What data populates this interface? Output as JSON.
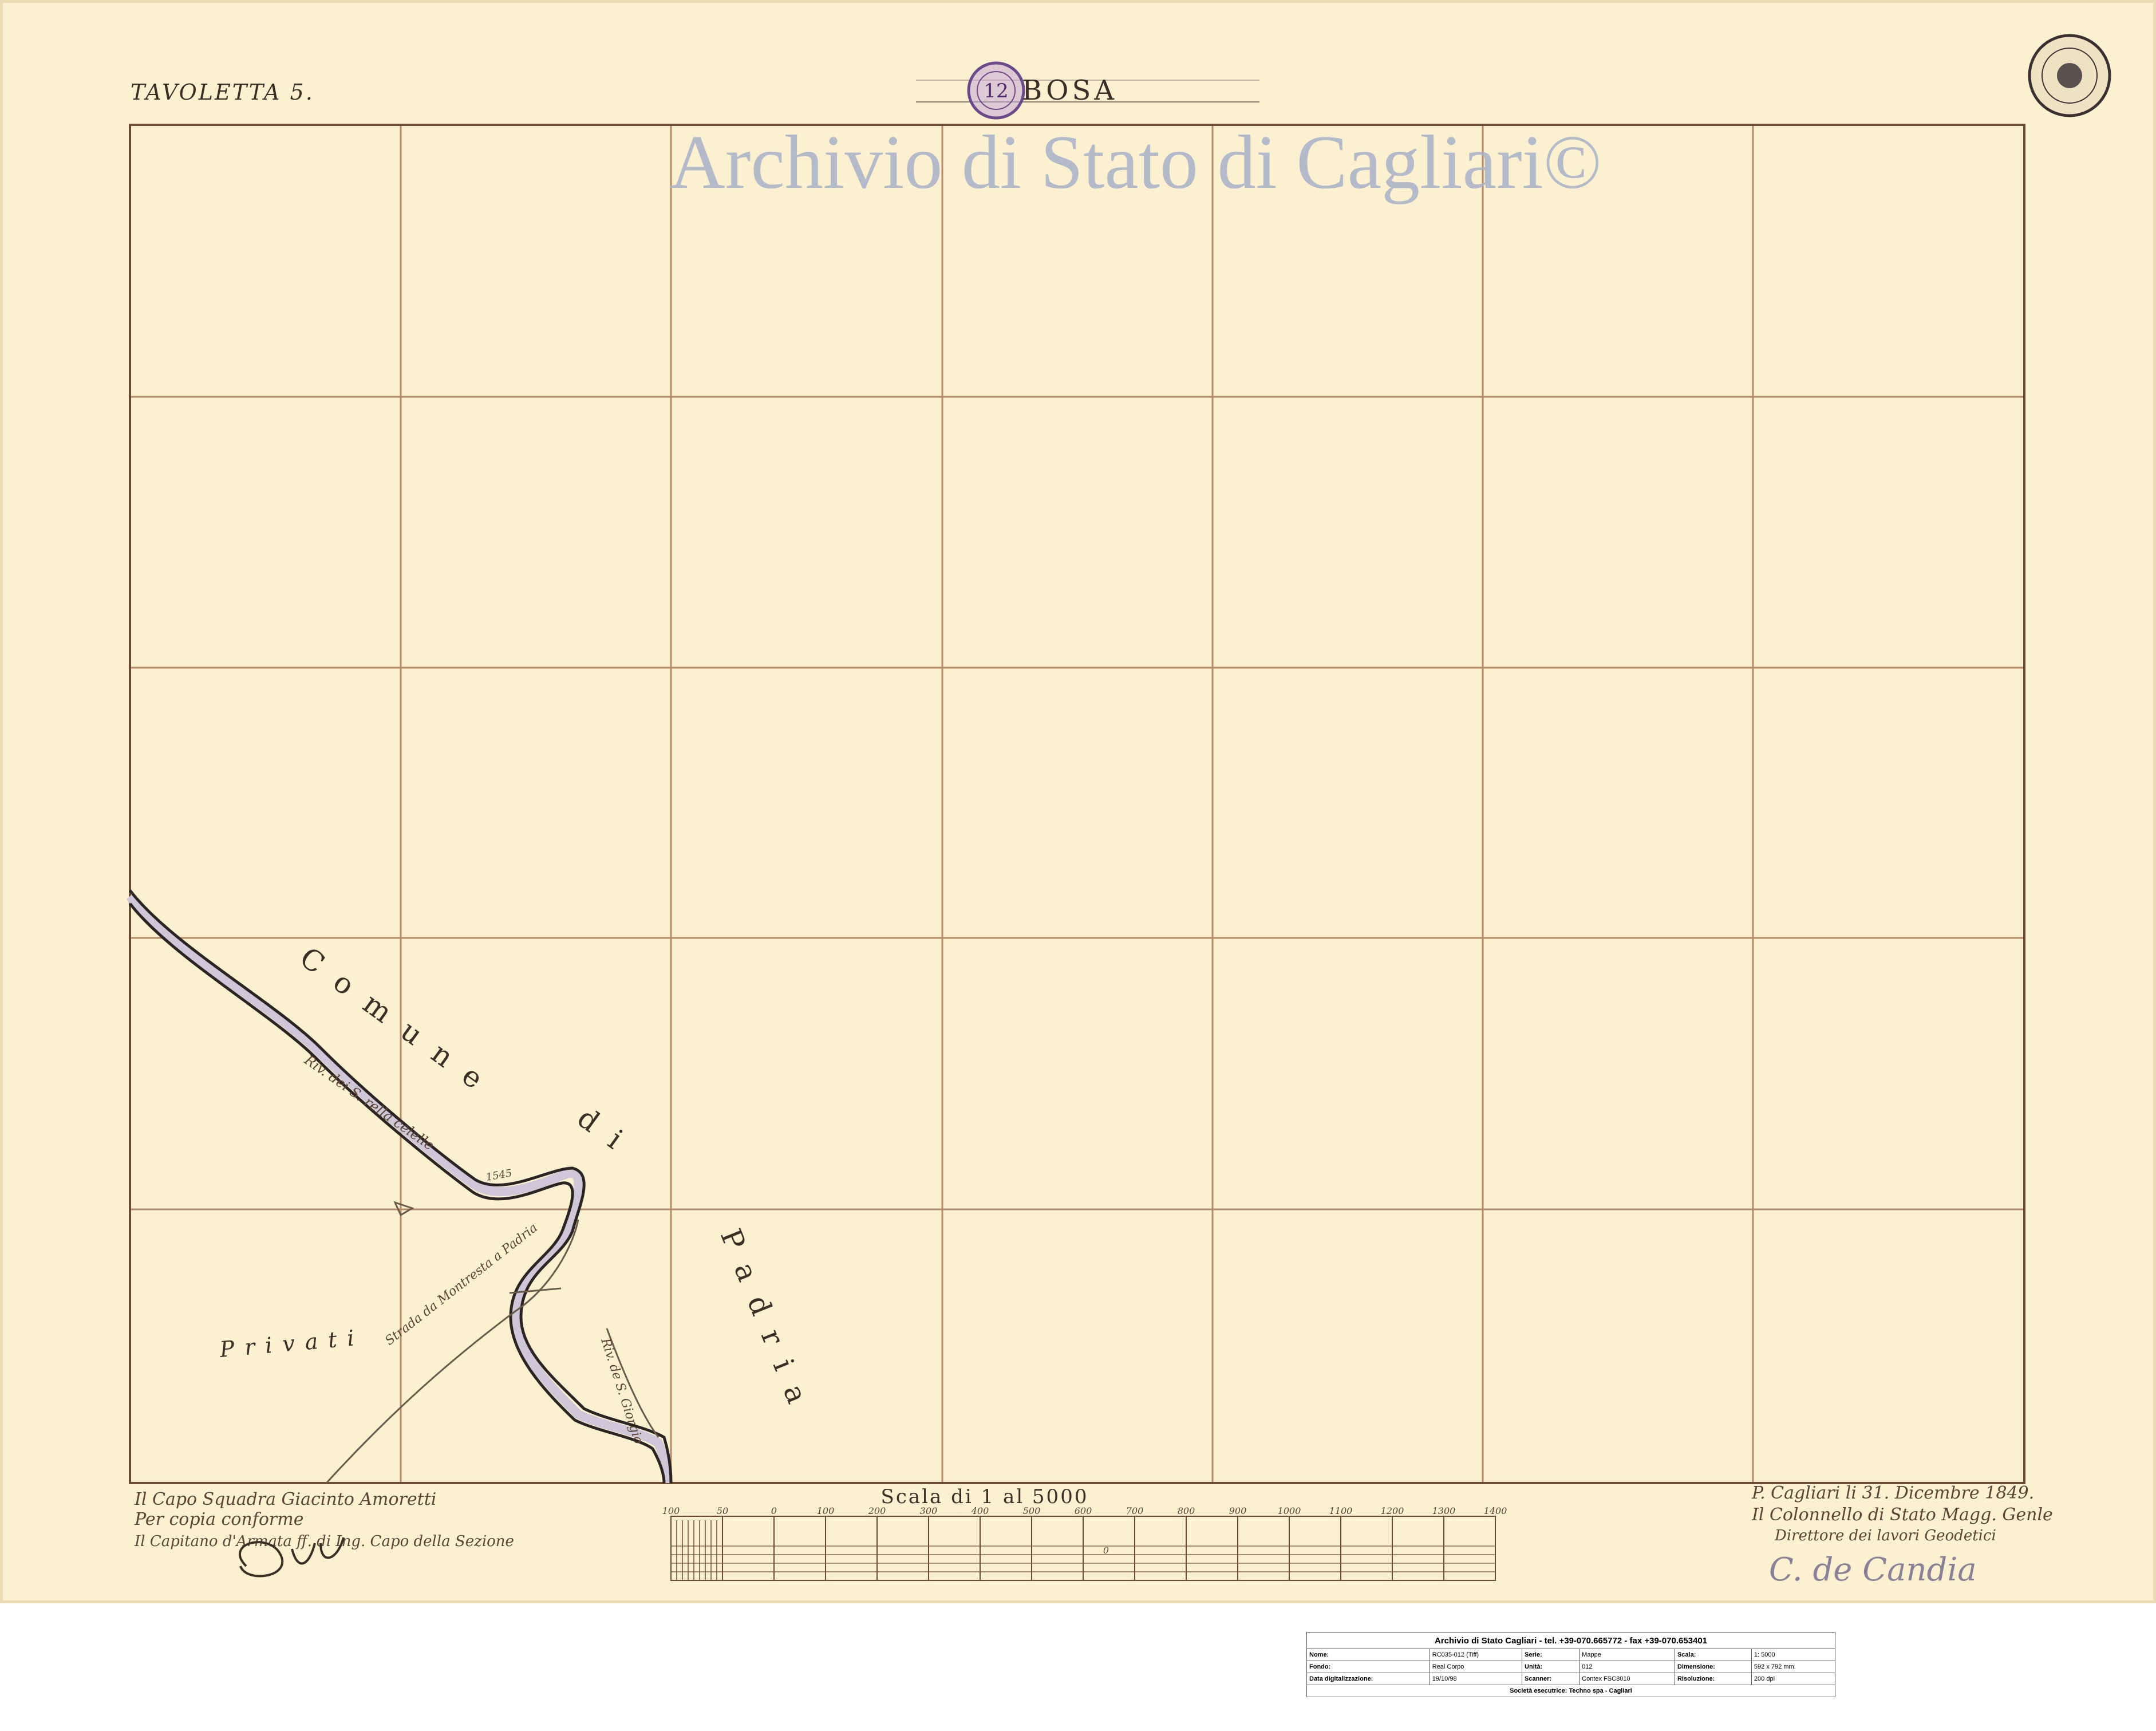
{
  "sheet": {
    "tavoletta": "TAVOLETTA 5.",
    "place": "BOSA",
    "stamp_number": "12",
    "watermark": "Archivio di Stato di Cagliari©"
  },
  "labels": {
    "comune": "Comune",
    "di": "di",
    "padria": "Padria",
    "privati": "Privati",
    "river_upper": "Riv. dei S. rella celelle",
    "river_lower": "Riv. de S. Giorgio",
    "road": "Strada da Montresta a Padria",
    "mark_1545": "1545"
  },
  "scale_bar": {
    "title": "Scala di 1 al 5000",
    "ticks": [
      "100",
      "50",
      "0",
      "100",
      "200",
      "300",
      "400",
      "500",
      "600",
      "700",
      "800",
      "900",
      "1000",
      "1100",
      "1200",
      "1300",
      "1400"
    ],
    "middle_digit": "0"
  },
  "signatures": {
    "left_line1": "Il Capo Squadra Giacinto Amoretti",
    "left_line2": "Per copia conforme",
    "left_line3": "Il Capitano d'Armata ff. di Ing. Capo della Sezione",
    "right_line1": "P. Cagliari li 31. Dicembre 1849.",
    "right_line2": "Il Colonnello di Stato Magg. Genle",
    "right_line3": "Direttore dei lavori Geodetici",
    "right_signature": "C. de Candia"
  },
  "info_table": {
    "header": "Archivio di Stato Cagliari - tel. +39-070.665772 - fax +39-070.653401",
    "rows": [
      [
        "Nome:",
        "RC035-012 (Tiff)",
        "Serie:",
        "Mappe",
        "Scala:",
        "1: 5000"
      ],
      [
        "Fondo:",
        "Real Corpo",
        "Unità:",
        "012",
        "Dimensione:",
        "592 x 792 mm."
      ],
      [
        "Data digitalizzazione:",
        "19/10/98",
        "Scanner:",
        "Contex FSC8010",
        "Risoluzione:",
        "200 dpi"
      ]
    ],
    "footer": "Società esecutrice: Techno spa - Cagliari"
  }
}
